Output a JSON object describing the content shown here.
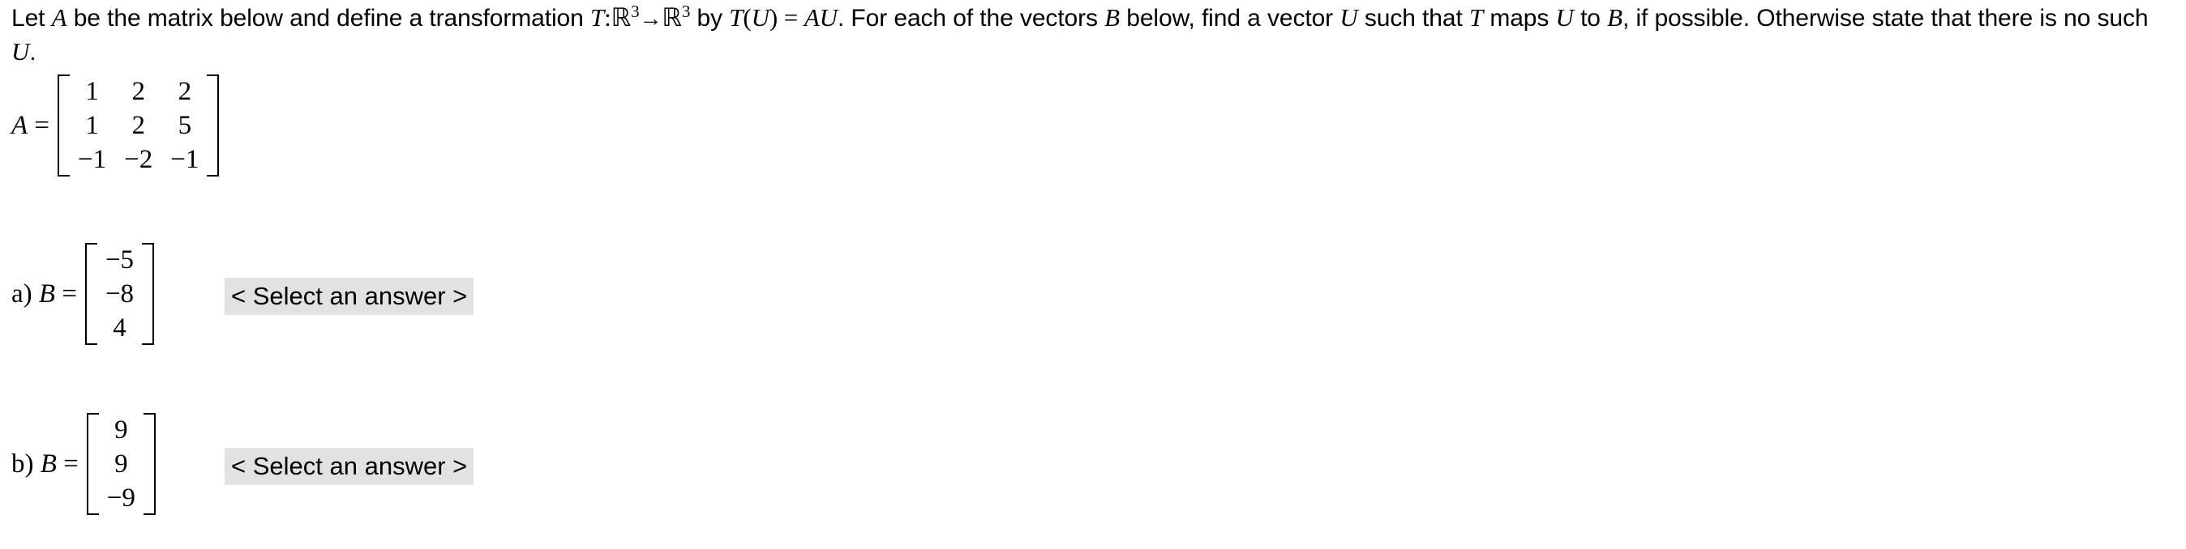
{
  "problem": {
    "line1_parts": {
      "t1": "Let ",
      "var_A": "A",
      "t2": " be the matrix below and define a transformation ",
      "var_T": "T",
      "colon": ":",
      "R1": "ℝ",
      "exp1": "3",
      "arrow": "→",
      "R2": "ℝ",
      "exp2": "3",
      "t3": " by ",
      "var_T2": "T",
      "paren_open": "(",
      "var_U": "U",
      "paren_close": ")",
      "equals": " = ",
      "var_AU": "AU",
      "t4": ". For each of the vectors ",
      "var_B": "B",
      "t5": " below, find a vector ",
      "var_U2": "U",
      "t6": " such that ",
      "var_T3": "T",
      "t7": " maps ",
      "var_U3": "U",
      "t8": " to ",
      "var_B2": "B",
      "t9": ", if possible. Otherwise state that there is no such ",
      "var_U4": "U",
      "t10": "."
    },
    "full_text": "Let A be the matrix below and define a transformation T:ℝ3→ℝ3 by T(U) = AU. For each of the vectors B below, find a vector U such that T maps U to B, if possible. Otherwise state that there is no such U."
  },
  "matrix_A": {
    "label_var": "A",
    "label_eq": " = ",
    "rows": [
      [
        "1",
        "2",
        "2"
      ],
      [
        "1",
        "2",
        "5"
      ],
      [
        "−1",
        "−2",
        "−1"
      ]
    ]
  },
  "parts": [
    {
      "id": "a",
      "label_prefix": "a) ",
      "label_var": "B",
      "label_eq": " = ",
      "vector": [
        "−5",
        "−8",
        "4"
      ],
      "answer_select": "< Select an answer >"
    },
    {
      "id": "b",
      "label_prefix": "b) ",
      "label_var": "B",
      "label_eq": " = ",
      "vector": [
        "9",
        "9",
        "−9"
      ],
      "answer_select": "< Select an answer >"
    }
  ],
  "colors": {
    "background": "#ffffff",
    "text": "#000000",
    "select_background": "#e2e2e2"
  }
}
